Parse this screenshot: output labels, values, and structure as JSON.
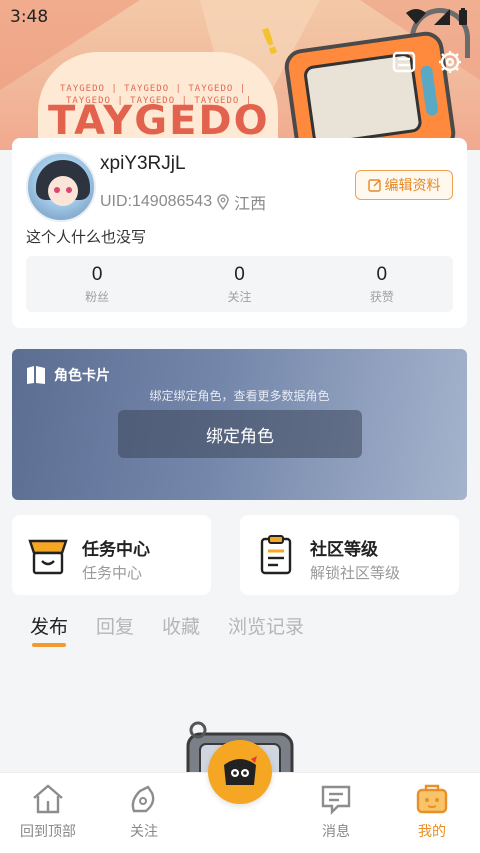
{
  "status": {
    "time": "3:48"
  },
  "banner": {
    "brand_small": "TAYGEDO | TAYGEDO | TAYGEDO |",
    "brand_big": "TAYGEDO"
  },
  "profile": {
    "username": "xpiY3RJjL",
    "uid": "UID:149086543",
    "location": "江西",
    "edit_label": "编辑资料",
    "bio": "这个人什么也没写",
    "stats": [
      {
        "num": "0",
        "label": "粉丝"
      },
      {
        "num": "0",
        "label": "关注"
      },
      {
        "num": "0",
        "label": "获赞"
      }
    ]
  },
  "character_card": {
    "title": "角色卡片",
    "subtitle": "绑定绑定角色，查看更多数据角色",
    "button": "绑定角色"
  },
  "tasks": {
    "title": "任务中心",
    "subtitle": "任务中心"
  },
  "community": {
    "title": "社区等级",
    "subtitle": "解锁社区等级"
  },
  "tabs": [
    {
      "label": "发布",
      "active": true
    },
    {
      "label": "回复"
    },
    {
      "label": "收藏"
    },
    {
      "label": "浏览记录"
    }
  ],
  "bottom_nav": [
    {
      "label": "回到顶部",
      "icon": "home-icon"
    },
    {
      "label": "关注",
      "icon": "follow-icon"
    },
    {
      "label": "",
      "icon": "center-mascot-icon"
    },
    {
      "label": "消息",
      "icon": "message-icon"
    },
    {
      "label": "我的",
      "icon": "profile-icon",
      "active": true
    }
  ],
  "colors": {
    "accent": "#f29a2e",
    "card_blue": "#6b7ea2"
  }
}
